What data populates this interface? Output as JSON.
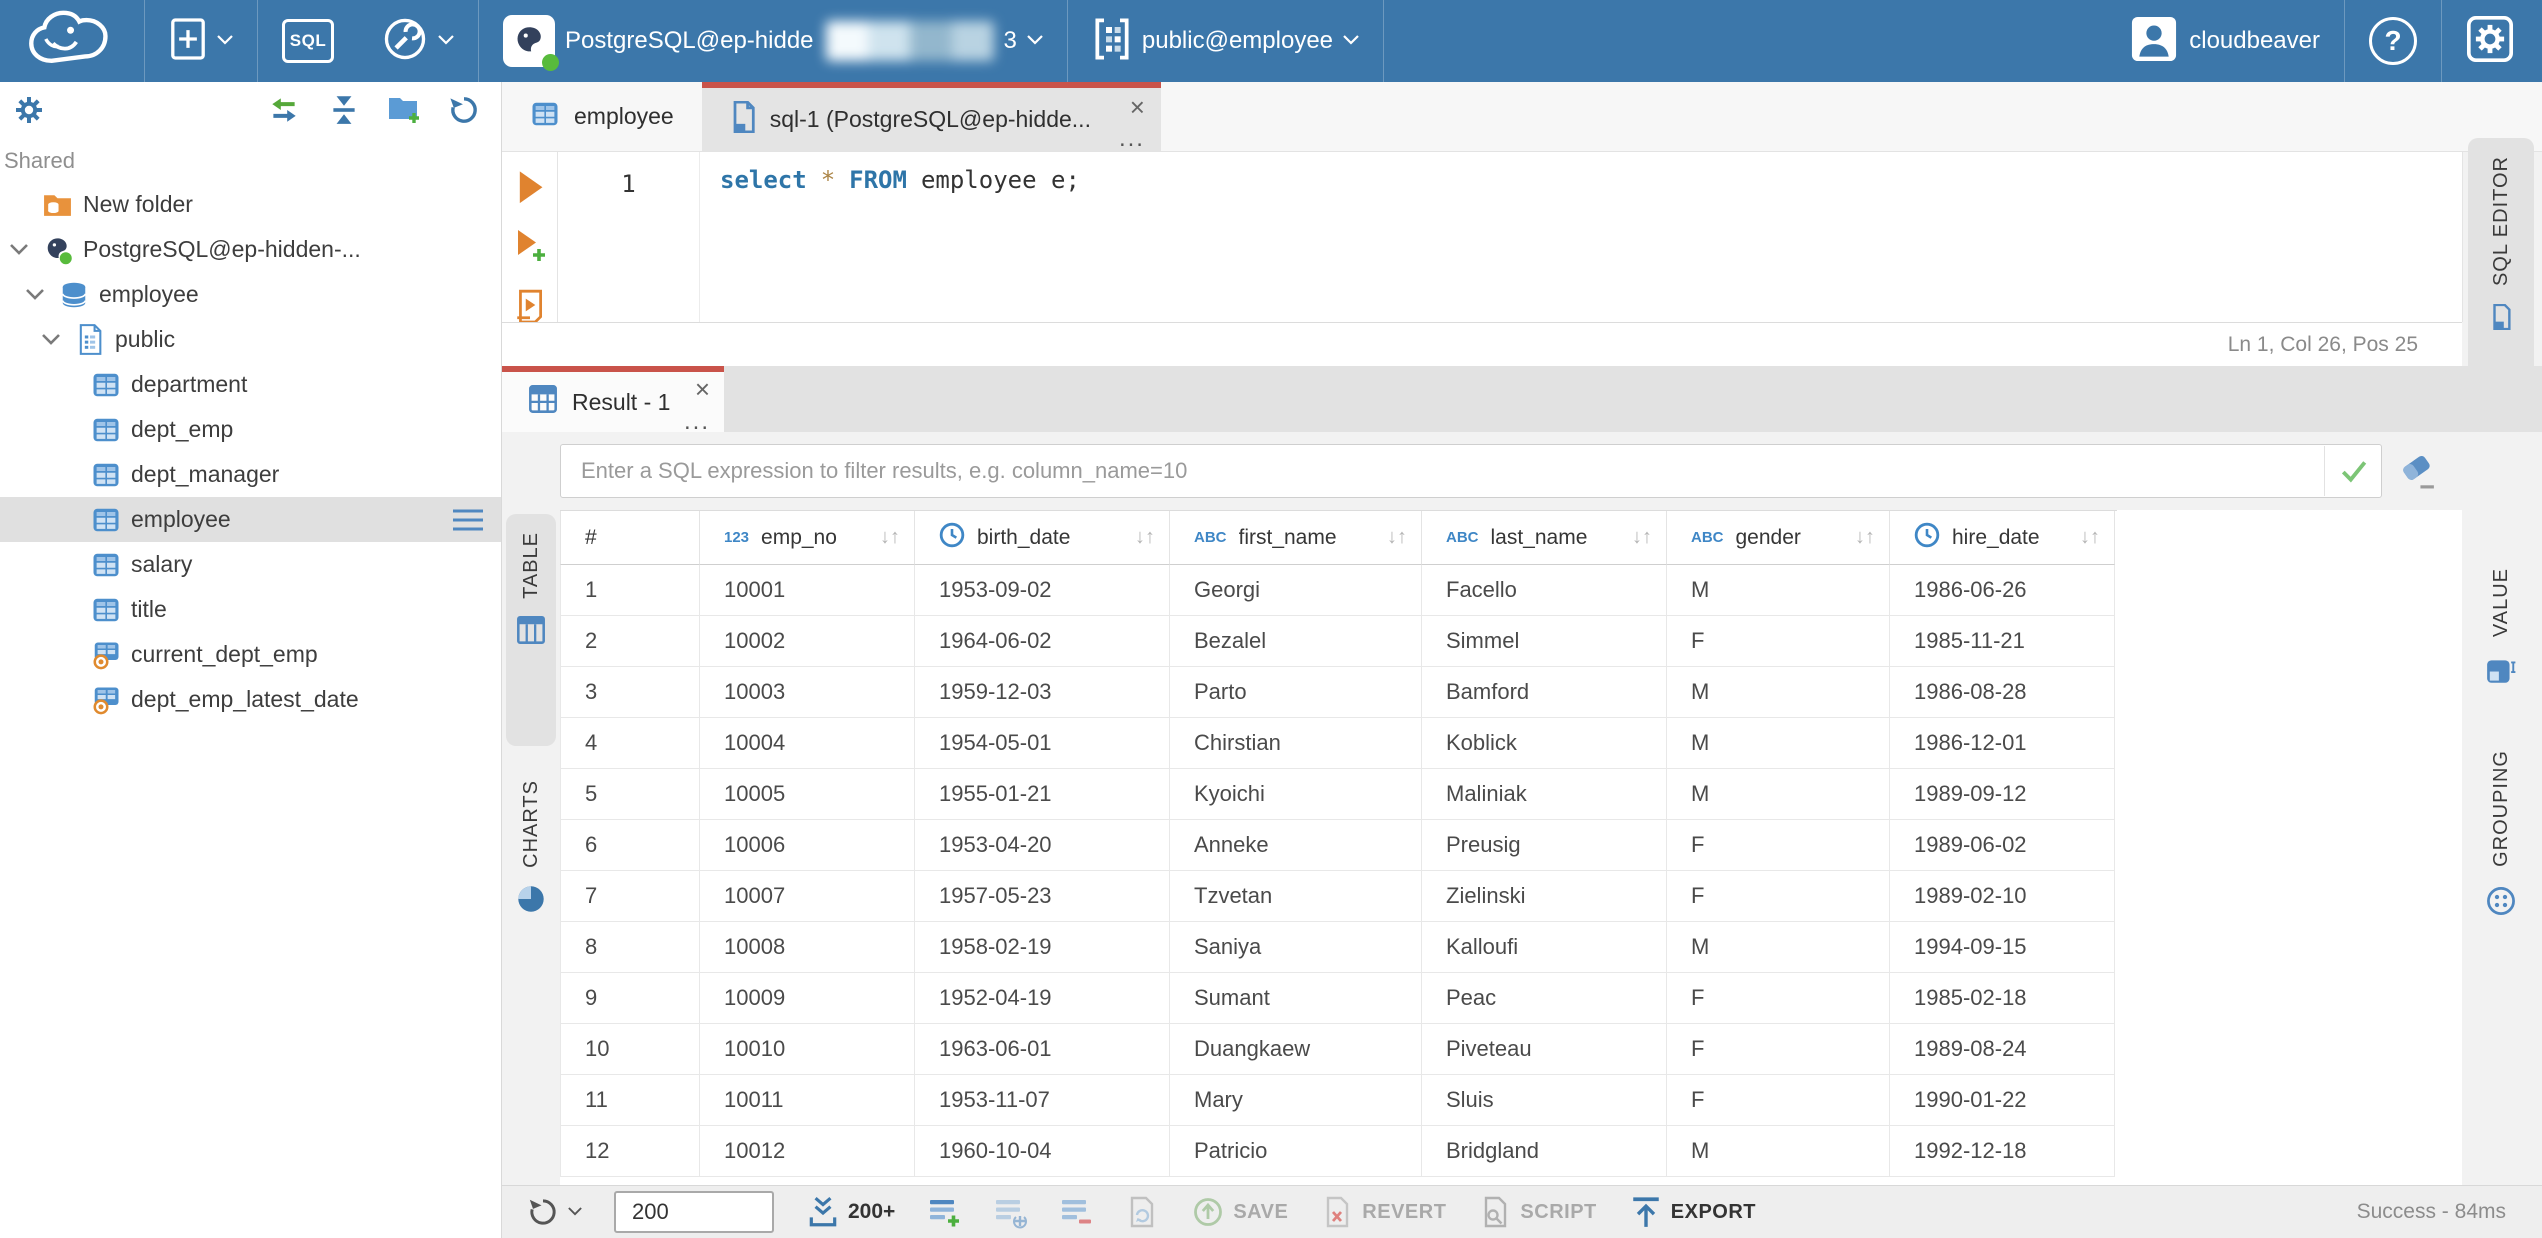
{
  "colors": {
    "topbar_blue": "#3C77AA",
    "accent_red": "#C9534A",
    "icon_blue": "#4F87C0",
    "success_green": "#58BB3C",
    "exec_orange": "#E0832F"
  },
  "topbar": {
    "sql_button_label": "SQL",
    "connection_label": "PostgreSQL@ep-hidde",
    "connection_suffix": "3",
    "schema_label": "public@employee",
    "username": "cloudbeaver",
    "help_glyph": "?"
  },
  "sidebar": {
    "section_label": "Shared",
    "tree": [
      {
        "label": "New folder",
        "icon": "folder-db",
        "level": 0,
        "expander": false
      },
      {
        "label": "PostgreSQL@ep-hidden-...",
        "icon": "postgres",
        "level": 0,
        "expander": true
      },
      {
        "label": "employee",
        "icon": "database",
        "level": 1,
        "expander": true
      },
      {
        "label": "public",
        "icon": "schema",
        "level": 2,
        "expander": true
      },
      {
        "label": "department",
        "icon": "table",
        "level": 3,
        "expander": false
      },
      {
        "label": "dept_emp",
        "icon": "table",
        "level": 3,
        "expander": false
      },
      {
        "label": "dept_manager",
        "icon": "table",
        "level": 3,
        "expander": false
      },
      {
        "label": "employee",
        "icon": "table",
        "level": 3,
        "expander": false,
        "selected": true
      },
      {
        "label": "salary",
        "icon": "table",
        "level": 3,
        "expander": false
      },
      {
        "label": "title",
        "icon": "table",
        "level": 3,
        "expander": false
      },
      {
        "label": "current_dept_emp",
        "icon": "view",
        "level": 3,
        "expander": false
      },
      {
        "label": "dept_emp_latest_date",
        "icon": "view",
        "level": 3,
        "expander": false
      }
    ]
  },
  "main_tabs": {
    "table_tab_label": "employee",
    "sql_tab_label": "sql-1 (PostgreSQL@ep-hidde...",
    "close_glyph": "×",
    "more_glyph": "..."
  },
  "editor": {
    "line_number": "1",
    "code_tokens": {
      "kw_select": "select",
      "star": "*",
      "kw_from": "FROM",
      "rest": "employee e;"
    },
    "status_line": "Ln 1, Col 26, Pos 25",
    "side_tab_label": "SQL EDITOR"
  },
  "result": {
    "tab_label": "Result - 1",
    "close_glyph": "×",
    "more_glyph": "...",
    "filter_placeholder": "Enter a SQL expression to filter results, e.g. column_name=10",
    "left_tabs": {
      "table_label": "TABLE",
      "charts_label": "CHARTS"
    },
    "right_tabs": {
      "value_label": "VALUE",
      "grouping_label": "GROUPING"
    },
    "grid": {
      "row_number_header": "#",
      "type_badges": {
        "number": "123",
        "string": "ABC"
      },
      "sort_glyph": "↓↑",
      "columns": [
        {
          "name": "emp_no",
          "type": "number"
        },
        {
          "name": "birth_date",
          "type": "date"
        },
        {
          "name": "first_name",
          "type": "string"
        },
        {
          "name": "last_name",
          "type": "string"
        },
        {
          "name": "gender",
          "type": "string"
        },
        {
          "name": "hire_date",
          "type": "date"
        }
      ],
      "rows": [
        [
          "1",
          "10001",
          "1953-09-02",
          "Georgi",
          "Facello",
          "M",
          "1986-06-26"
        ],
        [
          "2",
          "10002",
          "1964-06-02",
          "Bezalel",
          "Simmel",
          "F",
          "1985-11-21"
        ],
        [
          "3",
          "10003",
          "1959-12-03",
          "Parto",
          "Bamford",
          "M",
          "1986-08-28"
        ],
        [
          "4",
          "10004",
          "1954-05-01",
          "Chirstian",
          "Koblick",
          "M",
          "1986-12-01"
        ],
        [
          "5",
          "10005",
          "1955-01-21",
          "Kyoichi",
          "Maliniak",
          "M",
          "1989-09-12"
        ],
        [
          "6",
          "10006",
          "1953-04-20",
          "Anneke",
          "Preusig",
          "F",
          "1989-06-02"
        ],
        [
          "7",
          "10007",
          "1957-05-23",
          "Tzvetan",
          "Zielinski",
          "F",
          "1989-02-10"
        ],
        [
          "8",
          "10008",
          "1958-02-19",
          "Saniya",
          "Kalloufi",
          "M",
          "1994-09-15"
        ],
        [
          "9",
          "10009",
          "1952-04-19",
          "Sumant",
          "Peac",
          "F",
          "1985-02-18"
        ],
        [
          "10",
          "10010",
          "1963-06-01",
          "Duangkaew",
          "Piveteau",
          "F",
          "1989-08-24"
        ],
        [
          "11",
          "10011",
          "1953-11-07",
          "Mary",
          "Sluis",
          "F",
          "1990-01-22"
        ],
        [
          "12",
          "10012",
          "1960-10-04",
          "Patricio",
          "Bridgland",
          "M",
          "1992-12-18"
        ]
      ]
    }
  },
  "bottom_toolbar": {
    "rows_per_page_value": "200",
    "fetch_more_label": "200+",
    "save_label": "SAVE",
    "revert_label": "REVERT",
    "script_label": "SCRIPT",
    "export_label": "EXPORT",
    "status_message": "Success - 84ms"
  }
}
